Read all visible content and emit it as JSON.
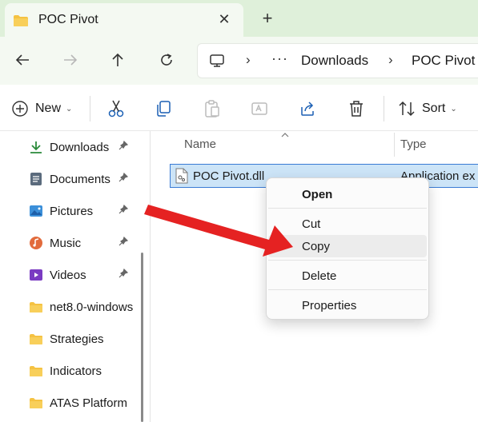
{
  "tab": {
    "title": "POC Pivot",
    "close": "✕",
    "new_tab": "+"
  },
  "address": {
    "overflow": "···",
    "crumbs": [
      "Downloads",
      "POC Pivot"
    ],
    "separator": "›"
  },
  "toolbar": {
    "new_label": "New",
    "sort_label": "Sort",
    "caret": "⌄"
  },
  "sidebar": {
    "items": [
      {
        "label": "Downloads",
        "icon": "download-icon",
        "pinned": true
      },
      {
        "label": "Documents",
        "icon": "document-icon",
        "pinned": true
      },
      {
        "label": "Pictures",
        "icon": "pictures-icon",
        "pinned": true
      },
      {
        "label": "Music",
        "icon": "music-icon",
        "pinned": true
      },
      {
        "label": "Videos",
        "icon": "videos-icon",
        "pinned": true
      },
      {
        "label": "net8.0-windows",
        "icon": "folder-icon",
        "pinned": false
      },
      {
        "label": "Strategies",
        "icon": "folder-icon",
        "pinned": false
      },
      {
        "label": "Indicators",
        "icon": "folder-icon",
        "pinned": false
      },
      {
        "label": "ATAS Platform",
        "icon": "folder-icon",
        "pinned": false
      }
    ]
  },
  "columns": {
    "name": "Name",
    "type": "Type"
  },
  "file": {
    "name": "POC Pivot.dll",
    "type": "Application ex"
  },
  "context_menu": {
    "open": "Open",
    "cut": "Cut",
    "copy": "Copy",
    "delete": "Delete",
    "properties": "Properties"
  },
  "colors": {
    "tab_bar": "#dff0da",
    "selection": "#cce4f7",
    "selection_border": "#3a7bd5",
    "arrow": "#e52222",
    "folder": "#f5c242"
  }
}
